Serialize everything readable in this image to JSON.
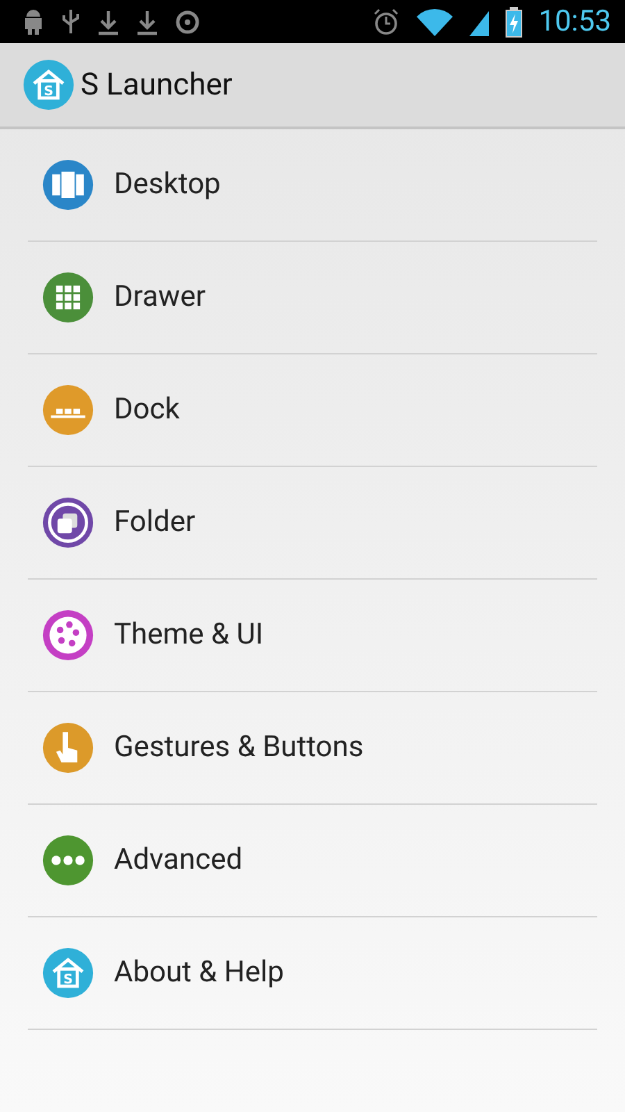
{
  "status_bar": {
    "time": "10:53"
  },
  "app_bar": {
    "title": "S Launcher",
    "icon_letter": "S"
  },
  "items": [
    {
      "label": "Desktop",
      "kind": "desktop",
      "color": "#2a86c8"
    },
    {
      "label": "Drawer",
      "kind": "drawer",
      "color": "#4b8f3a"
    },
    {
      "label": "Dock",
      "kind": "dock",
      "color": "#df9a2a"
    },
    {
      "label": "Folder",
      "kind": "folder",
      "color": "#7048a8"
    },
    {
      "label": "Theme & UI",
      "kind": "theme",
      "color": "#c43fc4"
    },
    {
      "label": "Gestures & Buttons",
      "kind": "gestures",
      "color": "#dc9a2a"
    },
    {
      "label": "Advanced",
      "kind": "advanced",
      "color": "#4e9630"
    },
    {
      "label": "About & Help",
      "kind": "about",
      "color": "#2fb0d8",
      "icon_letter": "S"
    }
  ]
}
